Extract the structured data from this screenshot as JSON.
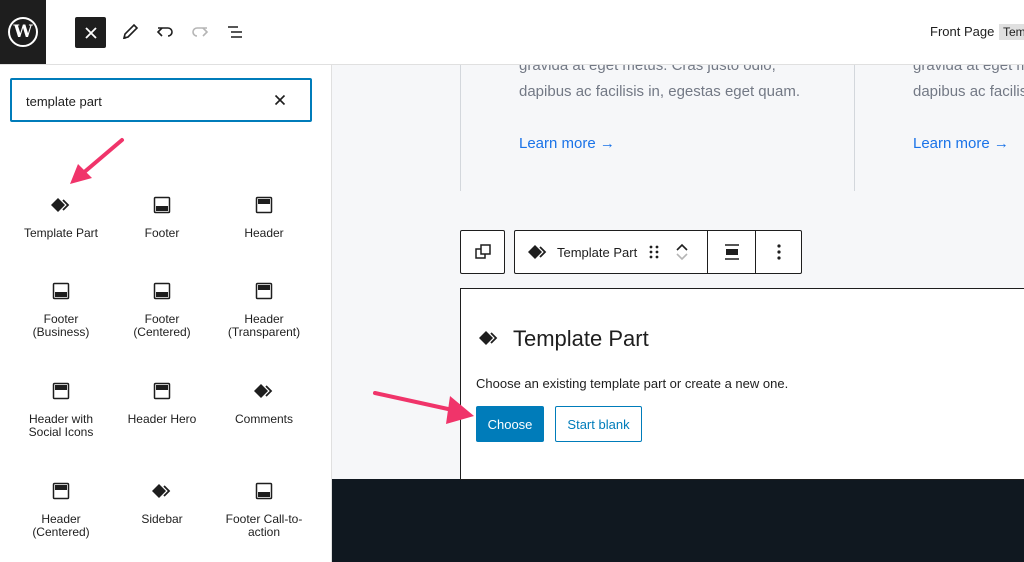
{
  "header": {
    "logo_glyph": "W",
    "breadcrumb": "Front Page",
    "breadcrumb_badge": "Tem"
  },
  "icons": [
    "wordpress-logo",
    "close-icon",
    "pencil-icon",
    "undo-icon",
    "redo-icon",
    "list-view-icon"
  ],
  "search": {
    "value": "template part"
  },
  "blocks": [
    {
      "label": "Template Part",
      "icon": "diamond"
    },
    {
      "label": "Footer",
      "icon": "footer"
    },
    {
      "label": "Header",
      "icon": "header"
    },
    {
      "label": "Footer\n(Business)",
      "icon": "footer"
    },
    {
      "label": "Footer\n(Centered)",
      "icon": "footer"
    },
    {
      "label": "Header\n(Transparent)",
      "icon": "header"
    },
    {
      "label": "Header with\nSocial Icons",
      "icon": "header"
    },
    {
      "label": "Header Hero",
      "icon": "header"
    },
    {
      "label": "Comments",
      "icon": "diamond"
    },
    {
      "label": "Header\n(Centered)",
      "icon": "header"
    },
    {
      "label": "Sidebar",
      "icon": "diamond"
    },
    {
      "label": "Footer Call-to-\naction",
      "icon": "footer"
    }
  ],
  "cards": [
    {
      "line1": "gravida at eget metus. Cras justo odio,",
      "line2": "dapibus ac facilisis in, egestas eget quam.",
      "link": "Learn more →"
    },
    {
      "line1": "gravida at eget metus. Cras justo odio,",
      "line2": "dapibus ac facilisis in, egestas eget quam.",
      "link": "Learn more →"
    }
  ],
  "block_toolbar": {
    "block_label": "Template Part"
  },
  "placeholder": {
    "title": "Template Part",
    "description": "Choose an existing template part or create a new one.",
    "choose": "Choose",
    "start_blank": "Start blank"
  },
  "colors": {
    "accent": "#007cba",
    "annotation_arrow": "#f0346a",
    "link": "#1a73e8",
    "dark_footer": "#101820"
  }
}
